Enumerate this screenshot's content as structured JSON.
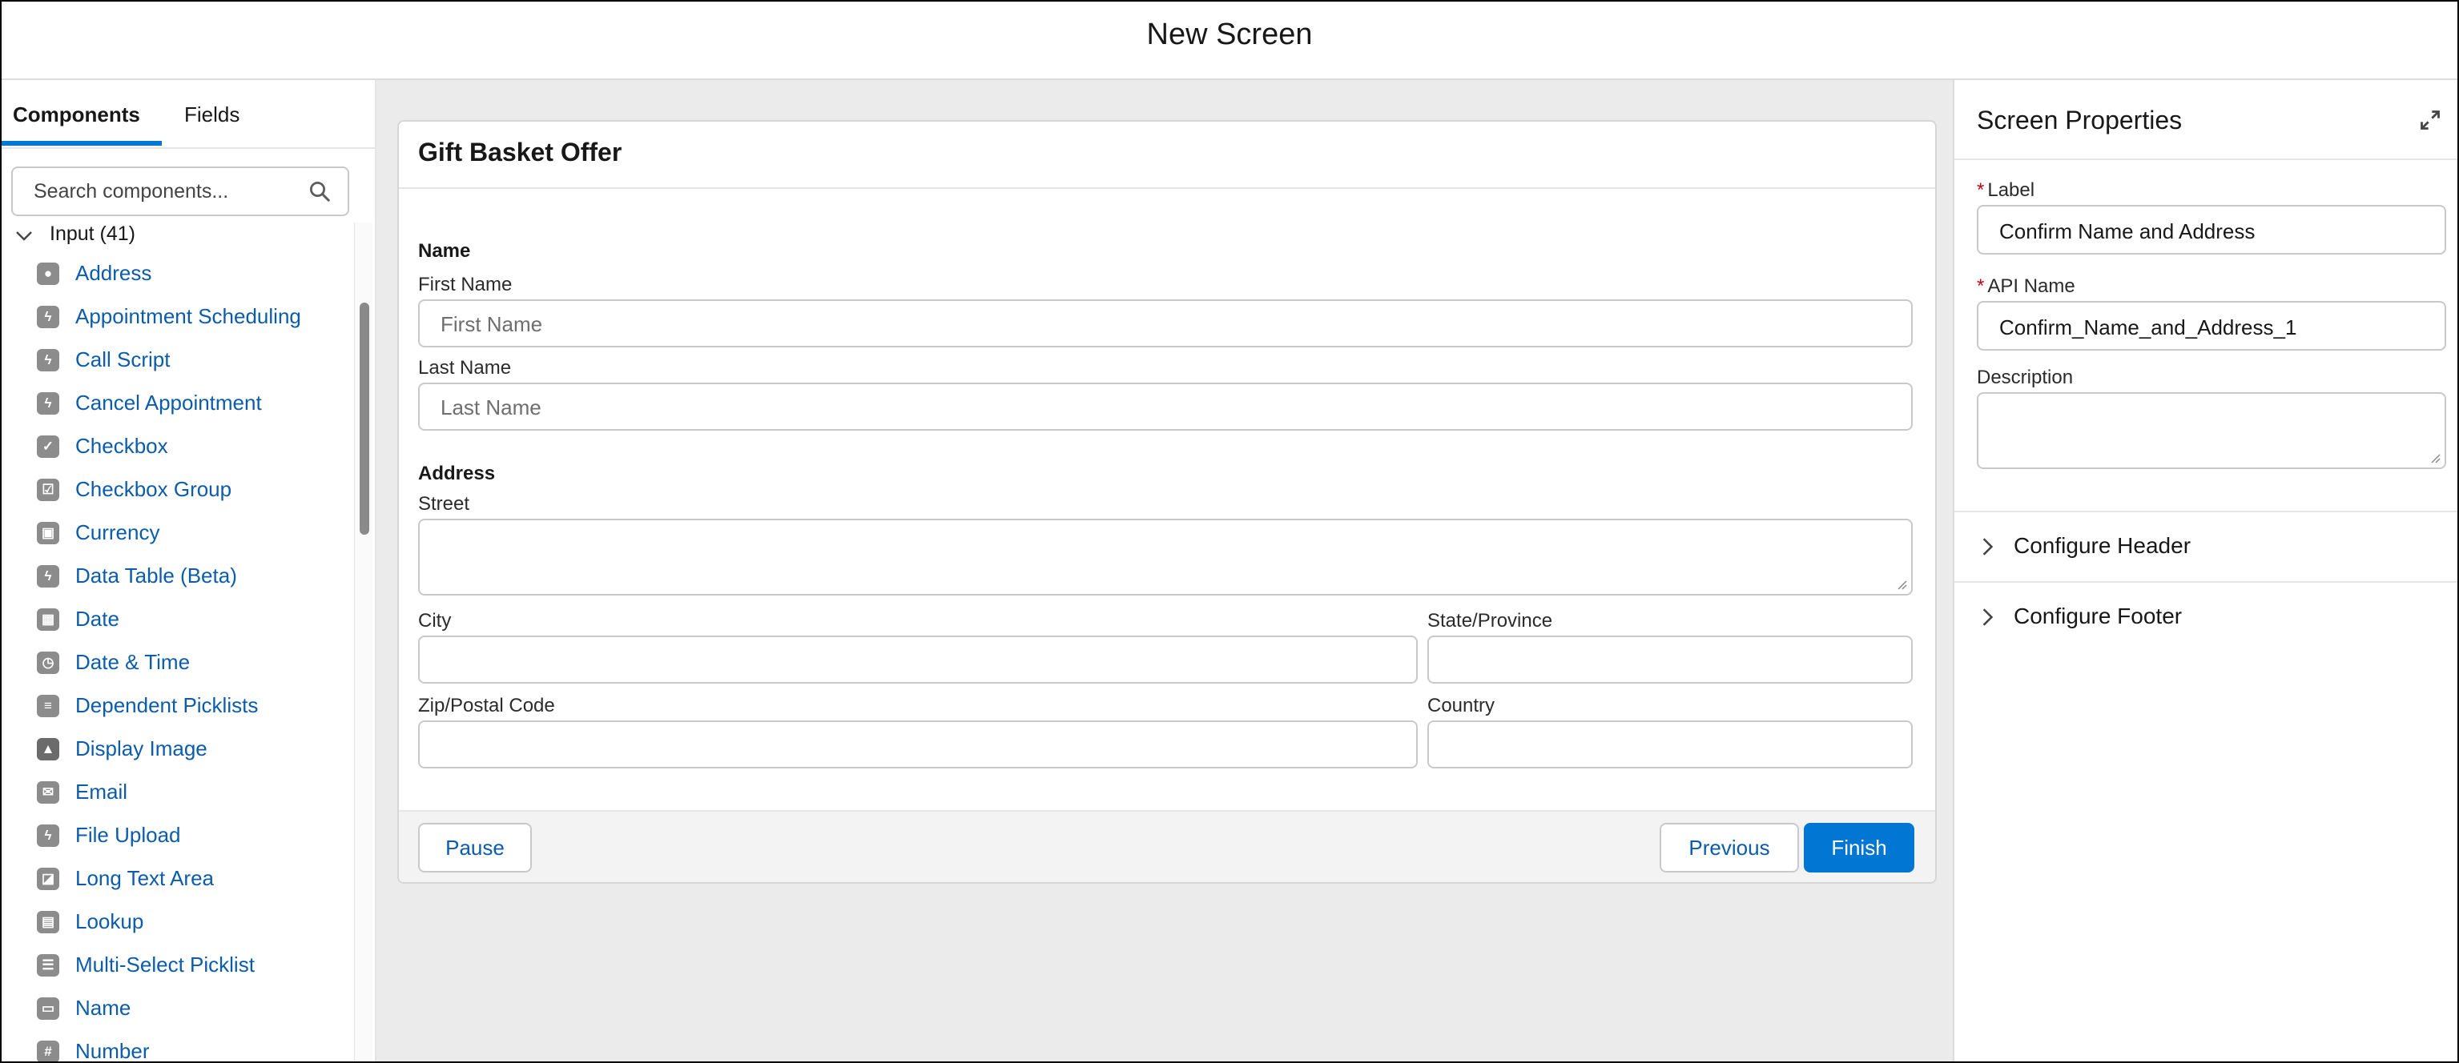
{
  "window": {
    "title": "New Screen"
  },
  "left_panel": {
    "tabs": [
      {
        "label": "Components"
      },
      {
        "label": "Fields"
      }
    ],
    "search": {
      "placeholder": "Search components..."
    },
    "group": {
      "label": "Input (41)",
      "expanded": true
    },
    "components": [
      {
        "label": "Address",
        "icon": "location-icon"
      },
      {
        "label": "Appointment Scheduling",
        "icon": "flow-icon"
      },
      {
        "label": "Call Script",
        "icon": "flow-icon"
      },
      {
        "label": "Cancel Appointment",
        "icon": "flow-icon"
      },
      {
        "label": "Checkbox",
        "icon": "checkbox-icon"
      },
      {
        "label": "Checkbox Group",
        "icon": "checkbox-group-icon"
      },
      {
        "label": "Currency",
        "icon": "currency-icon"
      },
      {
        "label": "Data Table (Beta)",
        "icon": "flow-icon"
      },
      {
        "label": "Date",
        "icon": "date-icon"
      },
      {
        "label": "Date & Time",
        "icon": "date-time-icon"
      },
      {
        "label": "Dependent Picklists",
        "icon": "picklist-icon"
      },
      {
        "label": "Display Image",
        "icon": "image-icon"
      },
      {
        "label": "Email",
        "icon": "email-icon"
      },
      {
        "label": "File Upload",
        "icon": "flow-icon"
      },
      {
        "label": "Long Text Area",
        "icon": "text-area-icon"
      },
      {
        "label": "Lookup",
        "icon": "lookup-icon"
      },
      {
        "label": "Multi-Select Picklist",
        "icon": "multi-picklist-icon"
      },
      {
        "label": "Name",
        "icon": "name-icon"
      },
      {
        "label": "Number",
        "icon": "number-icon"
      }
    ]
  },
  "screen": {
    "title": "Gift Basket Offer",
    "name_section": {
      "title": "Name",
      "first_name": {
        "label": "First Name",
        "placeholder": "First Name"
      },
      "last_name": {
        "label": "Last Name",
        "placeholder": "Last Name"
      }
    },
    "address_section": {
      "title": "Address",
      "street": {
        "label": "Street"
      },
      "city": {
        "label": "City"
      },
      "state": {
        "label": "State/Province"
      },
      "zip": {
        "label": "Zip/Postal Code"
      },
      "country": {
        "label": "Country"
      }
    },
    "footer": {
      "pause_label": "Pause",
      "previous_label": "Previous",
      "finish_label": "Finish"
    }
  },
  "properties": {
    "title": "Screen Properties",
    "label_field": {
      "label": "Label",
      "required_marker": "*",
      "value": "Confirm Name and Address"
    },
    "api_name_field": {
      "label": "API Name",
      "required_marker": "*",
      "value": "Confirm_Name_and_Address_1"
    },
    "description_field": {
      "label": "Description",
      "value": ""
    },
    "sections": [
      {
        "label": "Configure Header"
      },
      {
        "label": "Configure Footer"
      }
    ]
  },
  "colors": {
    "brand": "#0176d3",
    "link": "#0b5cab",
    "required": "#ba0517",
    "canvas_bg": "#ebebeb"
  }
}
